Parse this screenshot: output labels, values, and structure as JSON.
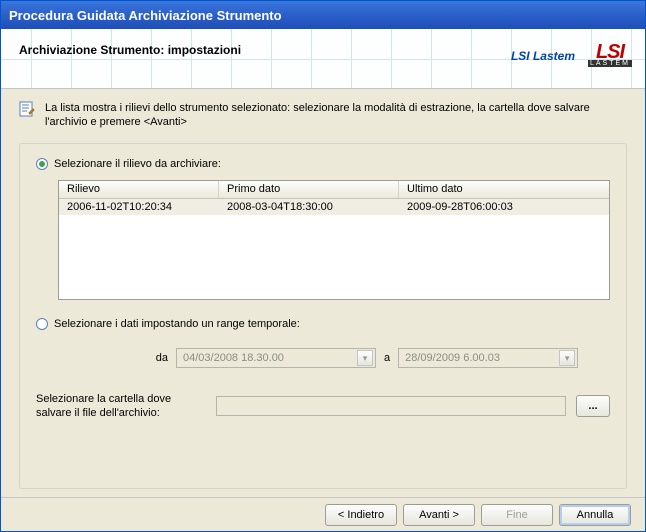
{
  "window": {
    "title": "Procedura Guidata Archiviazione Strumento"
  },
  "header": {
    "title": "Archiviazione Strumento: impostazioni",
    "brand_text": "LSI Lastem",
    "logo_top": "LSI",
    "logo_bottom": "LASTEM"
  },
  "intro": {
    "text": "La lista mostra i rilievi dello strumento selezionato: selezionare la modalità di estrazione, la cartella dove salvare l'archivio e premere <Avanti>"
  },
  "option_survey": {
    "label": "Selezionare il rilievo da archiviare:",
    "selected": true,
    "columns": {
      "c0": "Rilievo",
      "c1": "Primo dato",
      "c2": "Ultimo dato"
    },
    "rows": [
      {
        "c0": "2006-11-02T10:20:34",
        "c1": "2008-03-04T18:30:00",
        "c2": "2009-09-28T06:00:03"
      }
    ]
  },
  "option_range": {
    "label": "Selezionare i dati impostando un range temporale:",
    "selected": false,
    "from_label": "da",
    "from_value": "04/03/2008 18.30.00",
    "to_label": "a",
    "to_value": "28/09/2009  6.00.03"
  },
  "folder": {
    "label": "Selezionare la cartella dove salvare il file dell'archivio:",
    "value": "",
    "browse_label": "..."
  },
  "footer": {
    "back": "< Indietro",
    "next": "Avanti >",
    "finish": "Fine",
    "cancel": "Annulla"
  }
}
